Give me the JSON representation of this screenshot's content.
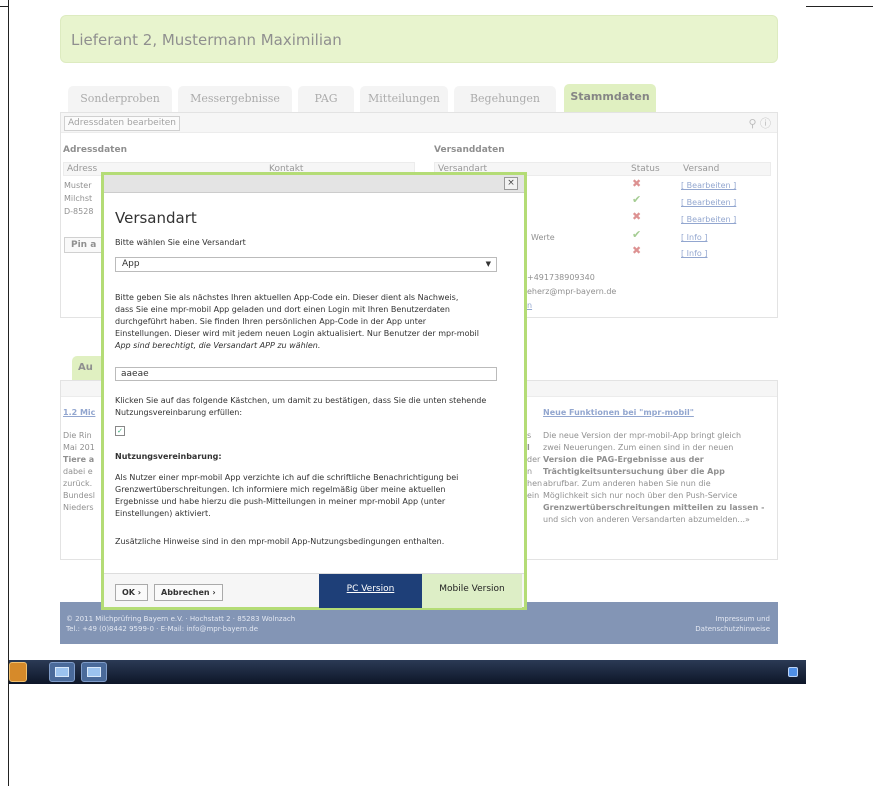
{
  "header": {
    "title": "Lieferant 2, Mustermann Maximilian"
  },
  "tabs": [
    {
      "label": "Sonderproben",
      "active": false
    },
    {
      "label": "Messergebnisse",
      "active": false
    },
    {
      "label": "PAG",
      "active": false
    },
    {
      "label": "Mitteilungen",
      "active": false
    },
    {
      "label": "Begehungen",
      "active": false
    },
    {
      "label": "Stammdaten",
      "active": true
    }
  ],
  "panel": {
    "edit_button": "Adressdaten bearbeiten",
    "address_title": "Adressdaten",
    "address_col": "Adress",
    "address_col2": "Kontakt",
    "address_lines": [
      "Muster",
      "Milchst",
      "D-8528"
    ],
    "pin_button": "Pin a",
    "shipping_title": "Versanddaten",
    "shipping_col_name": "Versandart",
    "shipping_col_status": "Status",
    "shipping_col_action": "Versand",
    "shipping_rows": [
      {
        "status": "x",
        "action": "[ Bearbeiten ]"
      },
      {
        "status": "ok",
        "action": "[ Bearbeiten ]"
      },
      {
        "status": "x",
        "action": "[ Bearbeiten ]"
      },
      {
        "status": "ok",
        "action": "[ Info ]",
        "name_partial": "Werte"
      },
      {
        "status": "x",
        "action": "[ Info ]"
      }
    ],
    "contact_phone": "+491738909340",
    "contact_email": "eherz@mpr-bayern.de",
    "contact_link": "n"
  },
  "section2": {
    "tab_label": "Au",
    "news_left_title": "1.2 Mic",
    "news_left_lines": [
      "Die Rin",
      "Mai 201",
      "Tiere a",
      "dabei e",
      "zurück.",
      "Bundesl",
      "Nieders"
    ],
    "news_mid_fragments": [
      "s",
      "l",
      "der",
      "n",
      "hen",
      "ein"
    ],
    "news_right_title": "Neue Funktionen bei \"mpr-mobil\"",
    "news_right_lines": [
      "Die neue Version der mpr-mobil-App bringt gleich",
      "zwei Neuerungen. Zum einen sind in der neuen",
      "Version die PAG-Ergebnisse aus der",
      "Trächtigkeitsuntersuchung über die App",
      "abrufbar. Zum anderen haben Sie nun die",
      "Möglichkeit sich nur noch über den Push-Service",
      "Grenzwertüberschreitungen mitteilen zu lassen -",
      "und sich von anderen Versandarten abzumelden...»"
    ]
  },
  "footer": {
    "line1": "© 2011 Milchprüfring Bayern e.V. · Hochstatt 2 · 85283 Wolnzach",
    "line2": "Tel.: +49 (0)8442 9599-0 · E-Mail: info@mpr-bayern.de",
    "right1": "Impressum und",
    "right2": "Datenschutzhinweise"
  },
  "modal": {
    "close_label": "×",
    "heading": "Versandart",
    "prompt": "Bitte wählen Sie eine Versandart",
    "select_value": "App",
    "select_arrow": "▼",
    "desc_lines": [
      "Bitte geben Sie als nächstes Ihren aktuellen App-Code ein. Dieser dient als Nachweis,",
      "dass Sie eine mpr-mobil App geladen und dort einen Login mit Ihren Benutzerdaten",
      "durchgeführt haben. Sie finden Ihren persönlichen App-Code in der App unter",
      "Einstellungen. Dieser wird mit jedem neuen Login aktualisiert. Nur Benutzer der mpr-mobil",
      "App sind berechtigt, die Versandart APP zu wählen."
    ],
    "app_code_value": "aaeae",
    "checkbox_lines": [
      "Klicken Sie auf das folgende Kästchen, um damit zu bestätigen, dass Sie die unten stehende",
      "Nutzungsvereinbarung erfüllen:"
    ],
    "checkbox_mark": "✓",
    "agreement_title": "Nutzungsvereinbarung:",
    "agreement_lines": [
      "Als Nutzer einer mpr-mobil App verzichte ich auf die schriftliche Benachrichtigung bei",
      "Grenzwertüberschreitungen. Ich informiere mich regelmäßig über meine aktuellen",
      "Ergebnisse und habe hierzu die push-Mitteilungen in meiner mpr-mobil App  (unter",
      "Einstellungen) aktiviert."
    ],
    "hint": "Zusätzliche Hinweise sind in den mpr-mobil App-Nutzungsbedingungen enthalten.",
    "ok_label": "OK ›",
    "cancel_label": "Abbrechen ›",
    "pc_version": "PC Version",
    "mobile_version": "Mobile Version"
  },
  "colors": {
    "accent_green": "#c7e38f",
    "header_green": "#d6eba6",
    "footer_blue": "#1e3f78",
    "status_error": "#c23a3a",
    "status_ok": "#5aa33a"
  }
}
